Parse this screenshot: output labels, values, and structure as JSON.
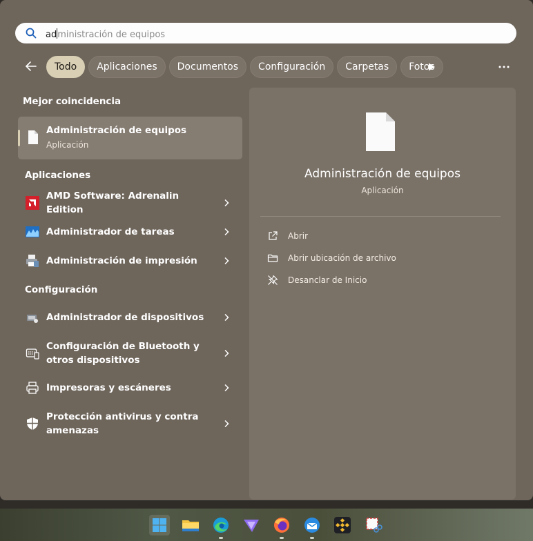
{
  "search": {
    "typed": "ad",
    "suggestion": "ministración de equipos"
  },
  "filters": {
    "items": [
      "Todo",
      "Aplicaciones",
      "Documentos",
      "Configuración",
      "Carpetas",
      "Fotos"
    ],
    "active": "Todo"
  },
  "best_match": {
    "heading": "Mejor coincidencia",
    "title": "Administración de equipos",
    "subtitle": "Aplicación"
  },
  "apps": {
    "heading": "Aplicaciones",
    "items": [
      {
        "label": "AMD Software: Adrenalin Edition",
        "icon": "amd-icon"
      },
      {
        "label": "Administrador de tareas",
        "icon": "task-manager-icon"
      },
      {
        "label": "Administración de impresión",
        "icon": "print-management-icon"
      }
    ]
  },
  "settings": {
    "heading": "Configuración",
    "items": [
      {
        "label": "Administrador de dispositivos",
        "icon": "device-manager-icon"
      },
      {
        "label": "Configuración de Bluetooth y otros dispositivos",
        "icon": "bluetooth-devices-icon"
      },
      {
        "label": "Impresoras y escáneres",
        "icon": "printer-icon"
      },
      {
        "label": "Protección antivirus y contra amenazas",
        "icon": "shield-icon"
      }
    ]
  },
  "detail": {
    "title": "Administración de equipos",
    "subtitle": "Aplicación",
    "actions": [
      {
        "label": "Abrir",
        "icon": "open-external-icon"
      },
      {
        "label": "Abrir ubicación de archivo",
        "icon": "folder-icon"
      },
      {
        "label": "Desanclar de Inicio",
        "icon": "unpin-icon"
      }
    ]
  },
  "taskbar": {
    "apps": [
      "windows-start-icon",
      "file-explorer-icon",
      "edge-icon",
      "proton-vpn-icon",
      "firefox-icon",
      "thunderbird-icon",
      "binance-icon",
      "snipping-tool-icon"
    ]
  },
  "colors": {
    "panel": "#6e655b",
    "active_chip": "#d8cfb5",
    "selected_row": "#857c72"
  }
}
